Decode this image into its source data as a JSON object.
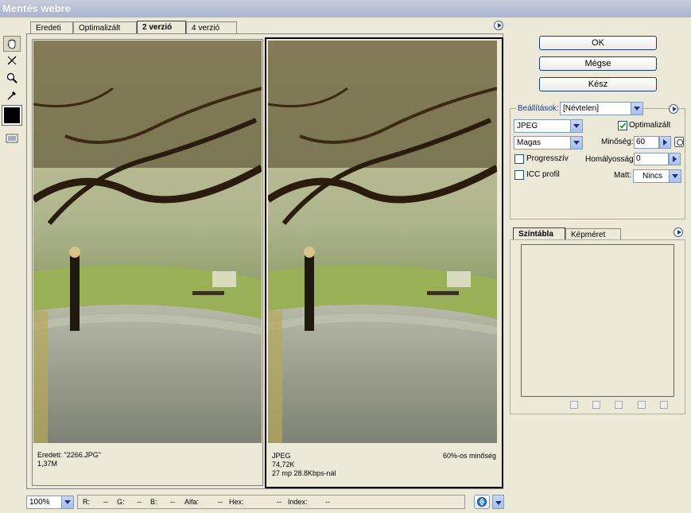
{
  "window": {
    "title": "Mentés webre"
  },
  "tabs": [
    {
      "label": "Eredeti"
    },
    {
      "label": "Optimalizált"
    },
    {
      "label": "2 verzió"
    },
    {
      "label": "4 verzió"
    }
  ],
  "left_panel": {
    "line1": "Eredeti: \"2266.JPG\"",
    "line2": "1,37M"
  },
  "right_panel": {
    "line1": "JPEG",
    "line2": "74,72K",
    "line3": "27 mp 28.8Kbps-nál",
    "quality_note": "60%-os minőség"
  },
  "buttons": {
    "ok": "OK",
    "cancel": "Mégse",
    "done": "Kész"
  },
  "settings": {
    "label": "Beállítások:",
    "preset": "[Névtelen]",
    "format": "JPEG",
    "quality_preset": "Magas",
    "optimized_label": "Optimalizált",
    "optimized_checked": true,
    "quality_label": "Minőség:",
    "quality_value": "60",
    "progressive_label": "Progresszív",
    "progressive_checked": false,
    "blur_label": "Homályosság:",
    "blur_value": "0",
    "icc_label": "ICC profil",
    "icc_checked": false,
    "matte_label": "Matt:",
    "matte_value": "Nincs"
  },
  "lower_tabs": [
    {
      "label": "Színtábla"
    },
    {
      "label": "Képméret"
    }
  ],
  "status": {
    "zoom": "100%",
    "r_label": "R:",
    "r_value": "--",
    "g_label": "G:",
    "g_value": "--",
    "b_label": "B:",
    "b_value": "--",
    "alpha_label": "Alfa:",
    "alpha_value": "--",
    "hex_label": "Hex:",
    "hex_value": "--",
    "index_label": "Index:",
    "index_value": "--"
  },
  "colors": {
    "accent": "#1a3a90",
    "titlebar": "#aab4cc",
    "panel": "#ece9d8"
  }
}
